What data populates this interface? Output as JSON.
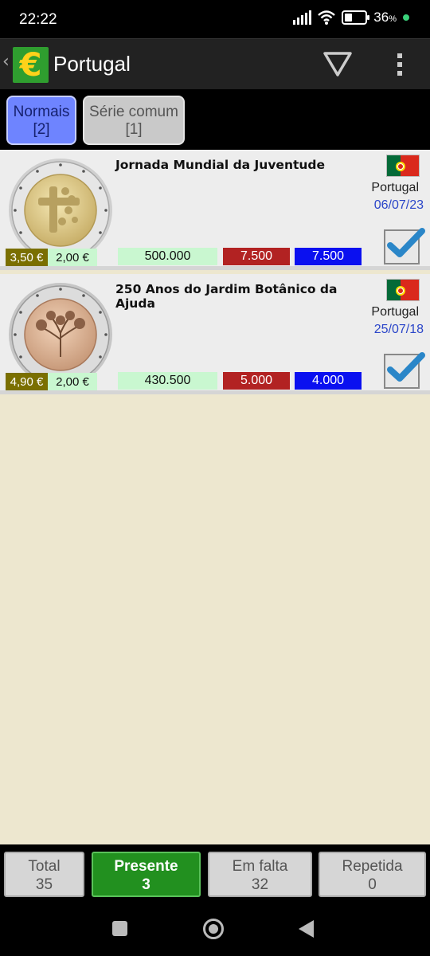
{
  "status_bar": {
    "time": "22:22",
    "battery": "36",
    "battery_unit": "%"
  },
  "app_bar": {
    "title": "Portugal",
    "logo_symbol": "€"
  },
  "tabs": [
    {
      "label": "Normais",
      "count": "[2]",
      "selected": true
    },
    {
      "label": "Série comum",
      "count": "[1]",
      "selected": false
    }
  ],
  "coins": [
    {
      "title": "Jornada Mundial da Juventude",
      "country": "Portugal",
      "date": "06/07/23",
      "price": "3,50 €",
      "face_value": "2,00 €",
      "mintage": "500.000",
      "red_value": "7.500",
      "blue_value": "7.500",
      "checked": true
    },
    {
      "title": "250 Anos do Jardim Botânico da Ajuda",
      "country": "Portugal",
      "date": "25/07/18",
      "price": "4,90 €",
      "face_value": "2,00 €",
      "mintage": "430.500",
      "red_value": "5.000",
      "blue_value": "4.000",
      "checked": true
    }
  ],
  "summary": {
    "total": {
      "label": "Total",
      "value": "35"
    },
    "presente": {
      "label": "Presente",
      "value": "3"
    },
    "em_falta": {
      "label": "Em falta",
      "value": "32"
    },
    "repetida": {
      "label": "Repetida",
      "value": "0"
    }
  },
  "colors": {
    "accent_green": "#22901f",
    "tab_selected": "#6e84ff",
    "date_blue": "#2b46c9",
    "red_badge": "#b22222",
    "blue_badge": "#0a10f0",
    "list_background": "#ede7cf"
  },
  "icons": [
    "back-chevron-icon",
    "euro-logo-icon",
    "filter-icon",
    "overflow-menu-icon",
    "portugal-flag-icon",
    "checkmark-icon",
    "nav-recents-icon",
    "nav-home-icon",
    "nav-back-icon"
  ]
}
